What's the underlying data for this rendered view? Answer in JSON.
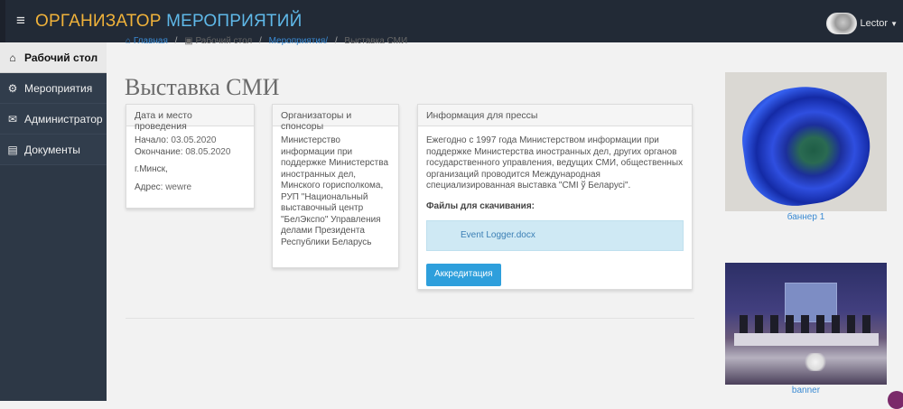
{
  "header": {
    "brand_part1": "ОРГАНИЗАТОР",
    "brand_part2": "МЕРОПРИЯТИЙ",
    "user_name": "Lector"
  },
  "sidebar": {
    "items": [
      {
        "label": "Рабочий стол",
        "icon": "home-icon"
      },
      {
        "label": "Мероприятия",
        "icon": "gear-icon"
      },
      {
        "label": "Администратор",
        "icon": "envelope-icon"
      },
      {
        "label": "Документы",
        "icon": "document-icon"
      }
    ]
  },
  "breadcrumb": {
    "home": "Главная",
    "desk": "Рабочий стол",
    "events": "Мероприятия/",
    "current": "Выставка СМИ"
  },
  "page": {
    "title": "Выставка СМИ"
  },
  "panel_date": {
    "header": "Дата и место проведения",
    "start_label": "Начало:",
    "start_value": "03.05.2020",
    "end_label": "Окончание:",
    "end_value": "08.05.2020",
    "city": "г.Минск,",
    "address_label": "Адрес:",
    "address_value": "wewre"
  },
  "panel_org": {
    "header": "Организаторы и спонсоры",
    "text": "Министерство информации при поддержке Министерства иностранных дел, Минского горисполкома, РУП \"Национальный выставочный центр \"БелЭкспо\" Управления делами Президента Республики Беларусь"
  },
  "panel_press": {
    "header": "Информация для прессы",
    "text": "Ежегодно с 1997 года Министерством информации при поддержке Министерства иностранных дел, других органов государственного управления, ведущих СМИ, общественных организаций проводится Международная специализированная выставка \"СМІ ў Беларусі\".",
    "files_label": "Файлы для скачивания:",
    "file_name": "Event Logger.docx",
    "button_label": "Аккредитация"
  },
  "banners": [
    {
      "caption": "баннер 1"
    },
    {
      "caption": "banner"
    }
  ]
}
